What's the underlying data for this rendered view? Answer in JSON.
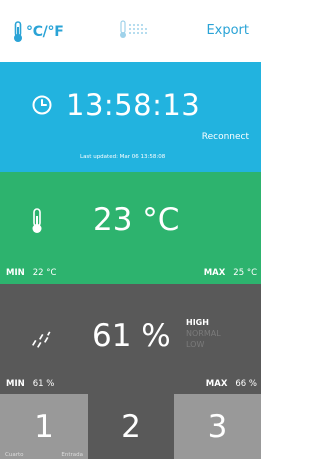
{
  "header": {
    "unit_toggle_label": "°C/°F",
    "export_label": "Export"
  },
  "time_panel": {
    "time": "13:58:13",
    "reconnect_label": "Reconnect",
    "last_updated": "Last updated: Mar 06 13:58:08"
  },
  "temperature_panel": {
    "value": "23 °C",
    "min_label": "MIN",
    "min_value": "22 °C",
    "max_label": "MAX",
    "max_value": "25 °C"
  },
  "humidity_panel": {
    "value": "61 %",
    "levels": [
      "HIGH",
      "NORMAL",
      "LOW"
    ],
    "active_level": "HIGH",
    "min_label": "MIN",
    "min_value": "61 %",
    "max_label": "MAX",
    "max_value": "66 %"
  },
  "channel_tabs": [
    {
      "label": "1",
      "sub_left": "Cuarto",
      "sub_right": "Entrada"
    },
    {
      "label": "2"
    },
    {
      "label": "3"
    }
  ],
  "colors": {
    "accent": "#2aa3d6",
    "time_panel_bg": "#22b3df",
    "temperature_panel_bg": "#2db36e",
    "humidity_panel_bg": "#595959",
    "tab_light": "#999999",
    "tab_dark": "#595959"
  },
  "icons": {
    "unit_toggle": "thermometer-icon",
    "humidity_toggle": "humidity-icon",
    "clock": "clock-icon",
    "temperature": "thermometer-icon",
    "humidity": "humidity-icon"
  }
}
